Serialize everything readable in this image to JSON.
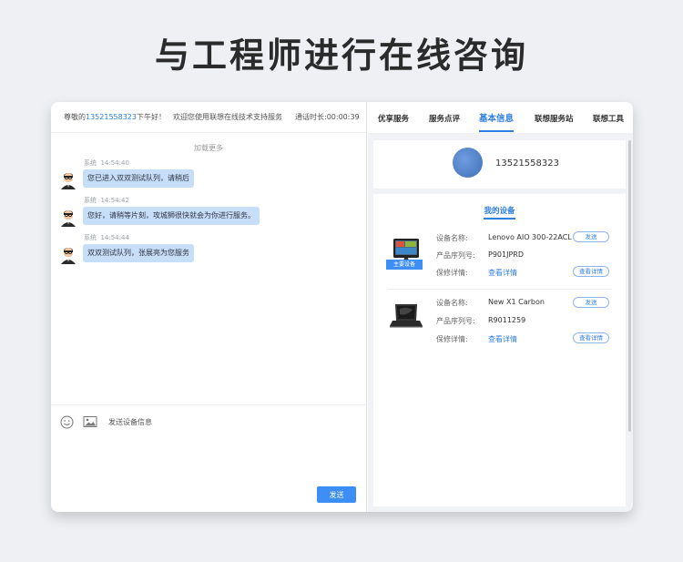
{
  "page_title": "与工程师进行在线咨询",
  "chat": {
    "header": {
      "greeting_prefix": "尊敬的",
      "phone": "13521558323",
      "greeting_suffix": "下午好！",
      "welcome": "欢迎您使用联想在线技术支持服务",
      "timer_label": "通话时长:",
      "timer_value": "00:00:39"
    },
    "load_more": "加载更多",
    "messages": [
      {
        "sender": "系统",
        "time": "14:54:40",
        "text": "您已进入双双测试队列，请稍后"
      },
      {
        "sender": "系统",
        "time": "14:54:42",
        "text": "您好，请稍等片刻，攻城狮很快就会为你进行服务。"
      },
      {
        "sender": "系统",
        "time": "14:54:44",
        "text": "双双测试队列，张展亮为您服务"
      }
    ],
    "send_device_label": "发送设备信息",
    "send_button": "发送"
  },
  "panel": {
    "tabs": [
      "优享服务",
      "服务点评",
      "基本信息",
      "联想服务站",
      "联想工具"
    ],
    "active_tab": "基本信息",
    "profile_phone": "13521558323",
    "devices_title": "我的设备",
    "devices": [
      {
        "name_label": "设备名称:",
        "name": "Lenovo AIO 300-22ACL",
        "serial_label": "产品序列号:",
        "serial": "P901JPRD",
        "warranty_label": "保修详情:",
        "warranty_link": "查看详情",
        "send": "发送",
        "detail": "查看详情",
        "badge": "主要设备"
      },
      {
        "name_label": "设备名称:",
        "name": "New X1 Carbon",
        "serial_label": "产品序列号:",
        "serial": "R9011259",
        "warranty_label": "保修详情:",
        "warranty_link": "查看详情",
        "send": "发送",
        "detail": "查看详情"
      }
    ]
  },
  "colors": {
    "accent": "#2f7fe0",
    "bubble": "#c6def7",
    "send_button": "#3d8ef5"
  }
}
